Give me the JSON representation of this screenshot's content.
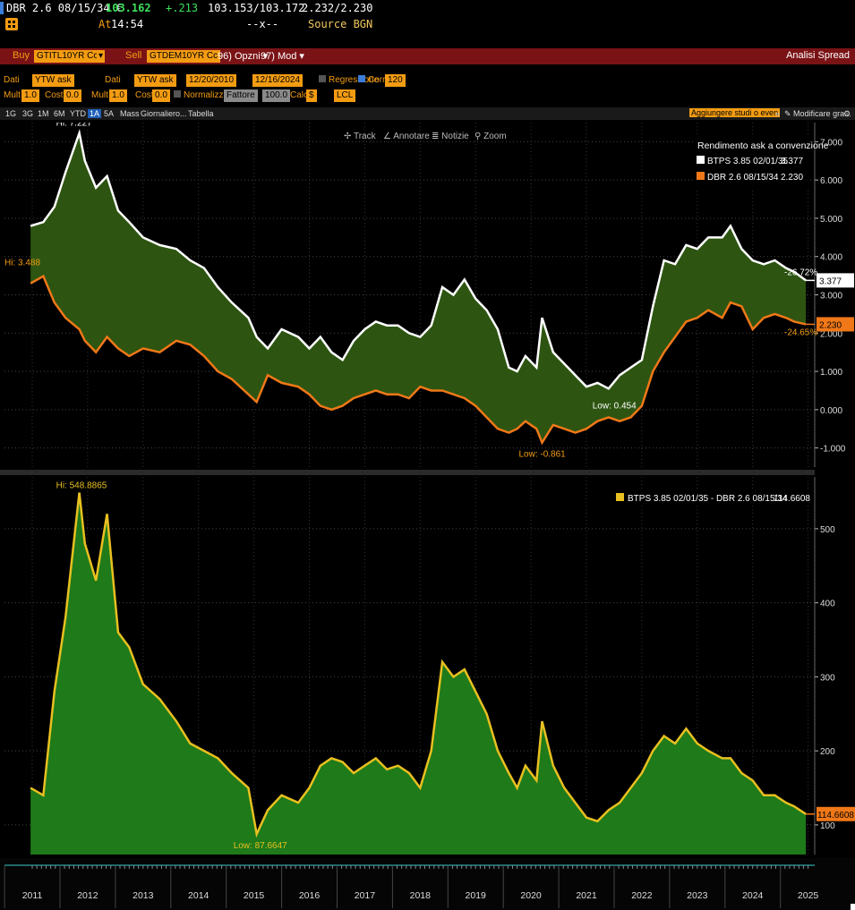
{
  "header": {
    "ticker": "DBR 2.6 08/15/34 €",
    "price": "103.162",
    "change": "+.213",
    "bid_ask": "103.153/103.172",
    "yield": "2.232/2.230",
    "at_label": "At",
    "time": "14:54",
    "sep": "--x--",
    "source": "Source BGN",
    "icon": "grid-icon"
  },
  "command_bar": {
    "buy_label": "Buy",
    "buy_ticker": "GTITL10YR Cc",
    "sell_label": "Sell",
    "sell_ticker": "GTDEM10YR Cc",
    "options": "96) Opzni ▾",
    "mod": "97) Mod ▾",
    "title": "Analisi Spread"
  },
  "params": {
    "dati1_label": "Dati",
    "dati1_value": "YTW ask",
    "dati2_label": "Dati",
    "dati2_value": "YTW ask",
    "date_from": "12/20/2010",
    "date_to": "12/16/2024",
    "regression": "Regressione",
    "corr": "Corr",
    "corr_value": "120",
    "mult1_label": "Mult",
    "mult1_value": "1.0",
    "cost1_label": "Cost",
    "cost1_value": "0.0",
    "mult2_label": "Mult",
    "mult2_value": "1.0",
    "cost2_label": "Cost",
    "cost2_value": "0.0",
    "normalize": "Normalizz p/",
    "normalize_value": "Fattore",
    "normalize_num": "100.0",
    "calc_label": "Calc",
    "calc_value": "$",
    "lcl_value": "LCL"
  },
  "tabs": {
    "items": [
      "1G",
      "3G",
      "1M",
      "6M",
      "YTD",
      "1A",
      "5A",
      "Mass",
      "Giornaliero...",
      "Tabella"
    ],
    "selected": "1A",
    "add_studies": "Aggiungere studi o even",
    "modify": "Modificare gra...",
    "toolbar": [
      "Track",
      "Annotare",
      "Notizie",
      "Zoom"
    ]
  },
  "chart_data": [
    {
      "type": "line",
      "legend_title": "Rendimento ask a convenzione",
      "legend_placement": "top-right",
      "x_ticks": [
        "2011",
        "2012",
        "2013",
        "2014",
        "2015",
        "2016",
        "2017",
        "2018",
        "2019",
        "2020",
        "2021",
        "2022",
        "2023",
        "2024",
        "2025"
      ],
      "ylim": [
        -1.5,
        7.5
      ],
      "y_ticks": [
        -1,
        0,
        1,
        2,
        3,
        4,
        5,
        6,
        7
      ],
      "y_tick_labels": [
        "-1.000",
        "0.000",
        "1.000",
        "2.000",
        "3.000",
        "4.000",
        "5.000",
        "6.000",
        "7.000"
      ],
      "fill_between": true,
      "series": [
        {
          "name": "BTPS 3.85 02/01/35",
          "last": "3.377",
          "color": "#ffffff",
          "annotation_high": "Hi: 7.227",
          "annotation_low": "Low: 0.454",
          "change_label": "-26.72%",
          "x": [
            2010.97,
            2011.2,
            2011.4,
            2011.6,
            2011.85,
            2011.95,
            2012.15,
            2012.35,
            2012.55,
            2012.75,
            2013.0,
            2013.3,
            2013.6,
            2013.85,
            2014.1,
            2014.35,
            2014.6,
            2014.9,
            2015.05,
            2015.25,
            2015.5,
            2015.8,
            2016.0,
            2016.2,
            2016.4,
            2016.6,
            2016.8,
            2017.0,
            2017.2,
            2017.4,
            2017.6,
            2017.8,
            2018.0,
            2018.2,
            2018.4,
            2018.6,
            2018.8,
            2019.0,
            2019.2,
            2019.4,
            2019.6,
            2019.75,
            2019.9,
            2020.1,
            2020.2,
            2020.4,
            2020.6,
            2020.8,
            2021.0,
            2021.2,
            2021.4,
            2021.6,
            2021.8,
            2022.0,
            2022.2,
            2022.4,
            2022.6,
            2022.8,
            2023.0,
            2023.2,
            2023.45,
            2023.6,
            2023.8,
            2024.0,
            2024.2,
            2024.4,
            2024.6,
            2024.75,
            2024.96
          ],
          "y": [
            4.8,
            4.9,
            5.3,
            6.2,
            7.227,
            6.5,
            5.8,
            6.1,
            5.2,
            4.9,
            4.5,
            4.3,
            4.2,
            3.9,
            3.7,
            3.2,
            2.8,
            2.4,
            1.9,
            1.6,
            2.1,
            1.9,
            1.6,
            1.9,
            1.5,
            1.3,
            1.8,
            2.1,
            2.3,
            2.2,
            2.2,
            2.0,
            1.9,
            2.2,
            3.2,
            3.0,
            3.4,
            2.9,
            2.6,
            2.1,
            1.1,
            1.0,
            1.4,
            1.1,
            2.4,
            1.5,
            1.2,
            0.9,
            0.6,
            0.7,
            0.55,
            0.9,
            1.1,
            1.3,
            2.7,
            3.9,
            3.8,
            4.3,
            4.2,
            4.5,
            4.5,
            4.8,
            4.2,
            3.9,
            3.8,
            3.9,
            3.7,
            3.6,
            3.377
          ]
        },
        {
          "name": "DBR 2.6 08/15/34",
          "last": "2.230",
          "color": "#f07818",
          "annotation_high": "Hi: 3.488",
          "annotation_low": "Low: -0.861",
          "change_label": "-24.65%",
          "x": [
            2010.97,
            2011.2,
            2011.4,
            2011.6,
            2011.85,
            2011.95,
            2012.15,
            2012.35,
            2012.55,
            2012.75,
            2013.0,
            2013.3,
            2013.6,
            2013.85,
            2014.1,
            2014.35,
            2014.6,
            2014.9,
            2015.05,
            2015.25,
            2015.5,
            2015.8,
            2016.0,
            2016.2,
            2016.4,
            2016.6,
            2016.8,
            2017.0,
            2017.2,
            2017.4,
            2017.6,
            2017.8,
            2018.0,
            2018.2,
            2018.4,
            2018.6,
            2018.8,
            2019.0,
            2019.2,
            2019.4,
            2019.6,
            2019.75,
            2019.9,
            2020.1,
            2020.2,
            2020.4,
            2020.6,
            2020.8,
            2021.0,
            2021.2,
            2021.4,
            2021.6,
            2021.8,
            2022.0,
            2022.2,
            2022.4,
            2022.6,
            2022.8,
            2023.0,
            2023.2,
            2023.45,
            2023.6,
            2023.8,
            2024.0,
            2024.2,
            2024.4,
            2024.6,
            2024.75,
            2024.96
          ],
          "y": [
            3.3,
            3.488,
            2.8,
            2.4,
            2.1,
            1.8,
            1.5,
            1.9,
            1.6,
            1.4,
            1.6,
            1.5,
            1.8,
            1.7,
            1.4,
            1.0,
            0.8,
            0.4,
            0.2,
            0.9,
            0.7,
            0.6,
            0.4,
            0.1,
            0.0,
            0.1,
            0.3,
            0.4,
            0.5,
            0.4,
            0.4,
            0.3,
            0.6,
            0.5,
            0.5,
            0.4,
            0.3,
            0.1,
            -0.2,
            -0.5,
            -0.6,
            -0.5,
            -0.3,
            -0.5,
            -0.861,
            -0.4,
            -0.5,
            -0.6,
            -0.5,
            -0.3,
            -0.2,
            -0.3,
            -0.2,
            0.1,
            1.0,
            1.5,
            1.9,
            2.3,
            2.4,
            2.6,
            2.4,
            2.8,
            2.7,
            2.1,
            2.4,
            2.5,
            2.4,
            2.3,
            2.23
          ]
        }
      ]
    },
    {
      "type": "area",
      "legend_placement": "top-right",
      "x_ticks": [
        "2011",
        "2012",
        "2013",
        "2014",
        "2015",
        "2016",
        "2017",
        "2018",
        "2019",
        "2020",
        "2021",
        "2022",
        "2023",
        "2024",
        "2025"
      ],
      "ylim": [
        60,
        570
      ],
      "y_ticks": [
        100,
        200,
        300,
        400,
        500
      ],
      "series": [
        {
          "name": "BTPS 3.85 02/01/35 - DBR 2.6 08/15/34",
          "last": "114.6608",
          "color": "#e8c020",
          "annotation_high": "Hi: 548.8865",
          "annotation_low": "Low: 87.6647",
          "x": [
            2010.97,
            2011.2,
            2011.4,
            2011.6,
            2011.85,
            2011.95,
            2012.15,
            2012.35,
            2012.55,
            2012.75,
            2013.0,
            2013.3,
            2013.6,
            2013.85,
            2014.1,
            2014.35,
            2014.6,
            2014.9,
            2015.05,
            2015.25,
            2015.5,
            2015.8,
            2016.0,
            2016.2,
            2016.4,
            2016.6,
            2016.8,
            2017.0,
            2017.2,
            2017.4,
            2017.6,
            2017.8,
            2018.0,
            2018.2,
            2018.4,
            2018.6,
            2018.8,
            2019.0,
            2019.2,
            2019.4,
            2019.6,
            2019.75,
            2019.9,
            2020.1,
            2020.2,
            2020.4,
            2020.6,
            2020.8,
            2021.0,
            2021.2,
            2021.4,
            2021.6,
            2021.8,
            2022.0,
            2022.2,
            2022.4,
            2022.6,
            2022.8,
            2023.0,
            2023.2,
            2023.45,
            2023.6,
            2023.8,
            2024.0,
            2024.2,
            2024.4,
            2024.6,
            2024.75,
            2024.96
          ],
          "y": [
            150,
            140,
            280,
            380,
            548.8865,
            480,
            430,
            520,
            360,
            340,
            290,
            270,
            240,
            210,
            200,
            190,
            170,
            150,
            87.6647,
            120,
            140,
            130,
            150,
            180,
            190,
            185,
            170,
            180,
            190,
            175,
            180,
            170,
            150,
            200,
            320,
            300,
            310,
            280,
            250,
            200,
            170,
            150,
            180,
            160,
            240,
            180,
            150,
            130,
            110,
            105,
            120,
            130,
            150,
            170,
            200,
            220,
            210,
            230,
            210,
            200,
            190,
            190,
            170,
            160,
            140,
            140,
            130,
            125,
            114.6608
          ]
        }
      ]
    }
  ]
}
